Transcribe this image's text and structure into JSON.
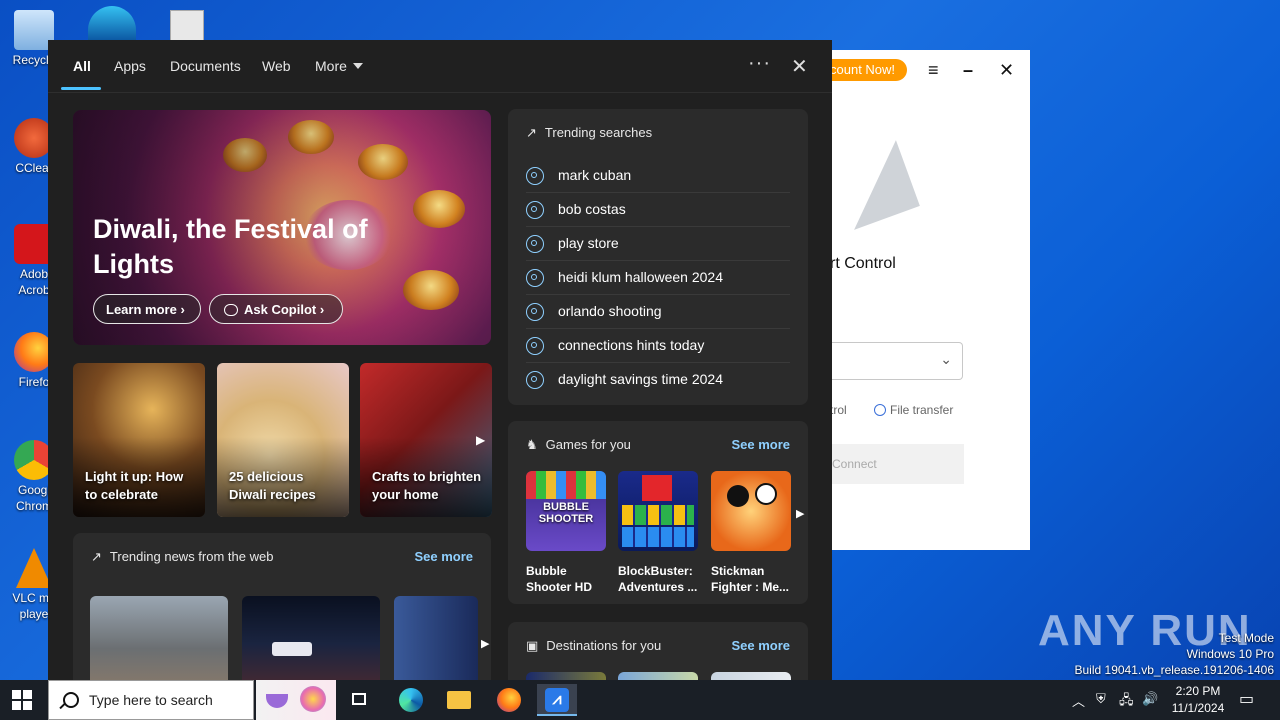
{
  "desktop": {
    "icons": [
      {
        "label": "Recycle",
        "icon": "recycle-bin-icon",
        "color": "#9ec7ee"
      },
      {
        "label": "CClear",
        "icon": "ccleaner-icon",
        "color": "#d94b2b"
      },
      {
        "label": "Adob Acrob",
        "icon": "acrobat-icon",
        "color": "#d4161b"
      },
      {
        "label": "Firefo",
        "icon": "firefox-icon",
        "color": "#ff7a16"
      },
      {
        "label": "Googl Chrom",
        "icon": "chrome-icon",
        "color": "#34a853"
      },
      {
        "label": "VLC me playe",
        "icon": "vlc-icon",
        "color": "#f08a00"
      }
    ]
  },
  "bg_window": {
    "promo": "count Now!",
    "title": "rt Control",
    "radio_control": "trol",
    "radio_file": "File transfer",
    "connect": "Connect"
  },
  "search_panel": {
    "tabs": [
      "All",
      "Apps",
      "Documents",
      "Web",
      "More"
    ],
    "active_tab": "All",
    "hero": {
      "title": "Diwali, the Festival of Lights",
      "learn_more": "Learn more",
      "ask_copilot": "Ask Copilot"
    },
    "cards": [
      "Light it up: How to celebrate",
      "25 delicious Diwali recipes",
      "Crafts to brighten your home"
    ],
    "trending": {
      "header": "Trending searches",
      "items": [
        "mark cuban",
        "bob costas",
        "play store",
        "heidi klum halloween 2024",
        "orlando shooting",
        "connections hints today",
        "daylight savings time 2024"
      ]
    },
    "games": {
      "header": "Games for you",
      "see_more": "See more",
      "items": [
        "Bubble Shooter HD",
        "BlockBuster: Adventures ...",
        "Stickman Fighter : Me..."
      ],
      "bubble_logo": "BUBBLE SHOOTER"
    },
    "news": {
      "header": "Trending news from the web",
      "see_more": "See more"
    },
    "destinations": {
      "header": "Destinations for you",
      "see_more": "See more"
    }
  },
  "watermark": {
    "brand": "ANY RUN",
    "test_mode": "Test Mode",
    "os": "Windows 10 Pro",
    "build": "Build 19041.vb_release.191206-1406"
  },
  "taskbar": {
    "search_placeholder": "Type here to search",
    "time": "2:20 PM",
    "date": "11/1/2024"
  },
  "colors": {
    "panel_bg": "#202020",
    "card_bg": "#2b2b2b",
    "accent": "#4cc2ff",
    "link": "#8fd0ff",
    "taskbar": "#1a1f26"
  }
}
